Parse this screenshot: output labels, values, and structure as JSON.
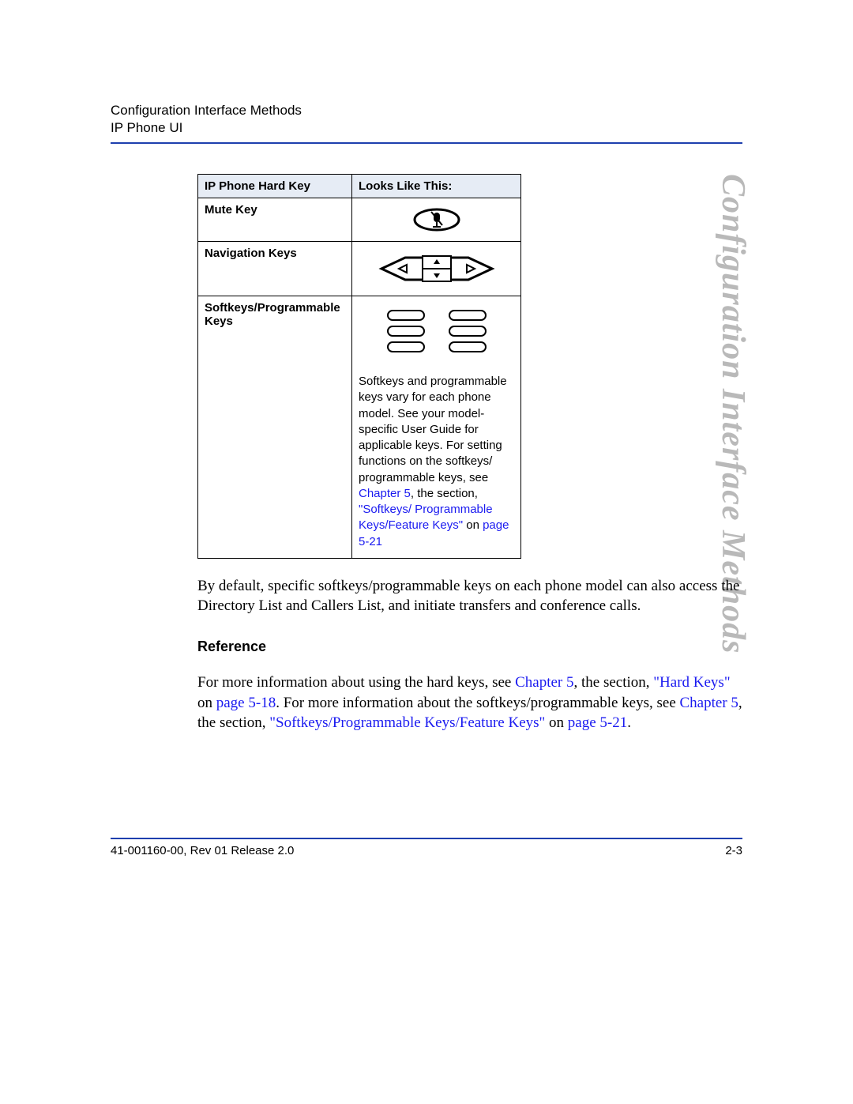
{
  "header": {
    "line1": "Configuration Interface Methods",
    "line2": "IP Phone UI"
  },
  "sideTitle": "Configuration Interface Methods",
  "table": {
    "headers": {
      "col1": "IP Phone Hard Key",
      "col2": "Looks Like This:"
    },
    "rows": [
      {
        "label": "Mute Key",
        "icon": "mute"
      },
      {
        "label": "Navigation Keys",
        "icon": "nav"
      },
      {
        "label": "Softkeys/Programmable Keys",
        "icon": "softkeys",
        "desc_pre": "Softkeys and programmable keys vary for each phone model. See your model-specific User Guide for applicable keys. For setting functions on the softkeys/ programmable keys, see ",
        "desc_link1": "Chapter 5",
        "desc_mid1": ", the section, ",
        "desc_link2": "\"Softkeys/ Programmable Keys/Feature Keys\"",
        "desc_mid2": " on ",
        "desc_link3": "page 5-21"
      }
    ]
  },
  "body": {
    "p1": "By default, specific softkeys/programmable keys on each phone model can also access the Directory List and Callers List, and initiate transfers and conference calls.",
    "refHead": "Reference",
    "ref_pre": "For more information about using the hard keys, see ",
    "ref_l1": "Chapter 5",
    "ref_m1": ", the section, ",
    "ref_l2": "\"Hard Keys\"",
    "ref_m2": " on ",
    "ref_l3": "page 5-18",
    "ref_m3": ". For more information about the softkeys/programmable keys, see ",
    "ref_l4": "Chapter 5",
    "ref_m4": ", the section, ",
    "ref_l5": "\"Softkeys/Programmable Keys/Feature Keys\"",
    "ref_m5": " on ",
    "ref_l6": "page 5-21",
    "ref_post": "."
  },
  "footer": {
    "left": "41-001160-00, Rev 01  Release 2.0",
    "right": "2-3"
  }
}
